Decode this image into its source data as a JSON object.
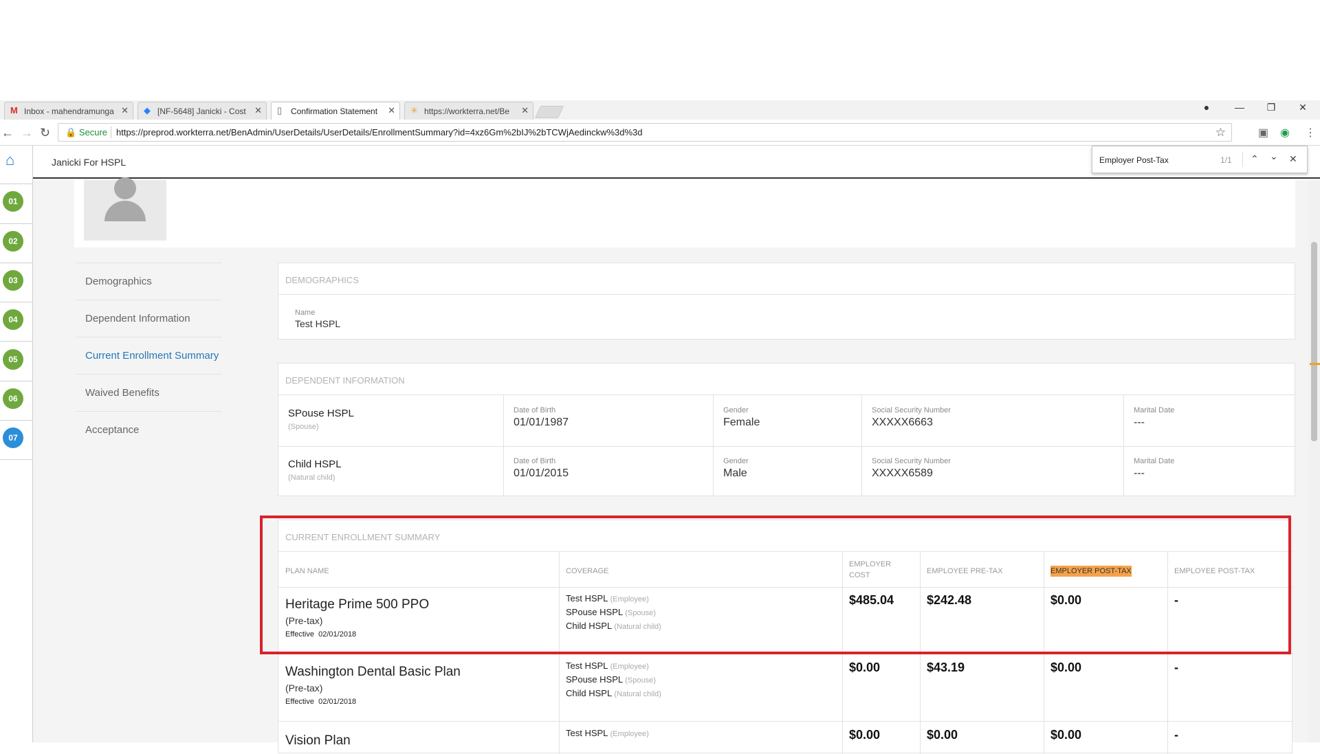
{
  "browser": {
    "tabs": [
      {
        "title": "Inbox - mahendramunga",
        "favicon": "gmail-icon"
      },
      {
        "title": "[NF-5648] Janicki - Cost",
        "favicon": "jira-icon"
      },
      {
        "title": "Confirmation Statement",
        "favicon": "document-icon"
      },
      {
        "title": "https://workterra.net/Be",
        "favicon": "loading-icon"
      }
    ],
    "secure_label": "Secure",
    "url": "https://preprod.workterra.net/BenAdmin/UserDetails/UserDetails/EnrollmentSummary?id=4xz6Gm%2bIJ%2bTCWjAedinckw%3d%3d"
  },
  "find_bar": {
    "query": "Employer Post-Tax",
    "count": "1/1"
  },
  "page": {
    "title": "Janicki For HSPL"
  },
  "rail": {
    "steps": [
      "01",
      "02",
      "03",
      "04",
      "05",
      "06",
      "07"
    ]
  },
  "sidenav": {
    "items": [
      "Demographics",
      "Dependent Information",
      "Current Enrollment Summary",
      "Waived Benefits",
      "Acceptance"
    ],
    "active": "Current Enrollment Summary"
  },
  "demographics": {
    "heading": "DEMOGRAPHICS",
    "name_label": "Name",
    "name_value": "Test HSPL"
  },
  "dependents": {
    "heading": "DEPENDENT INFORMATION",
    "labels": {
      "dob": "Date of Birth",
      "gender": "Gender",
      "ssn": "Social Security Number",
      "marital": "Marital Date"
    },
    "rows": [
      {
        "name": "SPouse HSPL",
        "relation": "(Spouse)",
        "dob": "01/01/1987",
        "gender": "Female",
        "ssn": "XXXXX6663",
        "marital": "---"
      },
      {
        "name": "Child HSPL",
        "relation": "(Natural child)",
        "dob": "01/01/2015",
        "gender": "Male",
        "ssn": "XXXXX6589",
        "marital": "---"
      }
    ]
  },
  "enrollment": {
    "heading": "CURRENT ENROLLMENT SUMMARY",
    "columns": {
      "plan": "PLAN NAME",
      "coverage": "COVERAGE",
      "employer_cost": "EMPLOYER COST",
      "employee_pretax": "EMPLOYEE PRE-TAX",
      "employer_posttax": "EMPLOYER POST-TAX",
      "employee_posttax": "EMPLOYEE POST-TAX"
    },
    "rows": [
      {
        "plan": "Heritage Prime 500 PPO",
        "tax": "(Pre-tax)",
        "effective_label": "Effective",
        "effective": "02/01/2018",
        "coverage": [
          {
            "name": "Test HSPL",
            "rel": "(Employee)"
          },
          {
            "name": "SPouse HSPL",
            "rel": "(Spouse)"
          },
          {
            "name": "Child HSPL",
            "rel": "(Natural child)"
          }
        ],
        "employer_cost": "$485.04",
        "employee_pretax": "$242.48",
        "employer_posttax": "$0.00",
        "employee_posttax": "-"
      },
      {
        "plan": "Washington Dental Basic Plan",
        "tax": "(Pre-tax)",
        "effective_label": "Effective",
        "effective": "02/01/2018",
        "coverage": [
          {
            "name": "Test HSPL",
            "rel": "(Employee)"
          },
          {
            "name": "SPouse HSPL",
            "rel": "(Spouse)"
          },
          {
            "name": "Child HSPL",
            "rel": "(Natural child)"
          }
        ],
        "employer_cost": "$0.00",
        "employee_pretax": "$43.19",
        "employer_posttax": "$0.00",
        "employee_posttax": "-"
      },
      {
        "plan": "Vision Plan",
        "coverage": [
          {
            "name": "Test HSPL",
            "rel": "(Employee)"
          }
        ],
        "employer_cost": "$0.00",
        "employee_pretax": "$0.00",
        "employer_posttax": "$0.00",
        "employee_posttax": "-"
      }
    ]
  },
  "colors": {
    "accent_blue": "#2577b5",
    "step_green": "#6fa83d",
    "step_current": "#2b8ed8",
    "annotation_red": "#d8232a",
    "find_highlight": "#f6a24a"
  }
}
